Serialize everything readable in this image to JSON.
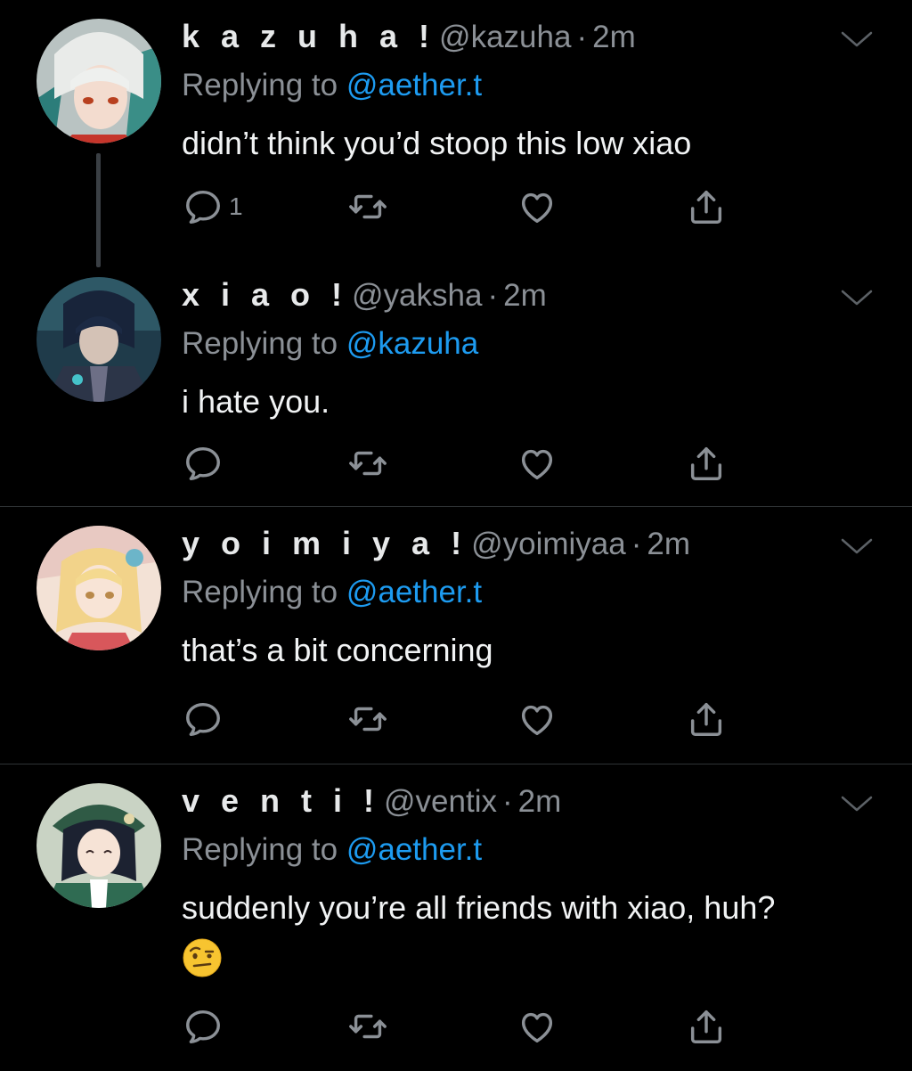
{
  "tweets": [
    {
      "name": "k a z u h a !",
      "handle": "@kazuha",
      "time": "2m",
      "replying_label": "Replying to",
      "replying_to": "@aether.t",
      "text": "didn’t think you’d stoop this low xiao",
      "reply_count": "1",
      "avatar": "kazuha-avatar"
    },
    {
      "name": "x i a o !",
      "handle": "@yaksha",
      "time": "2m",
      "replying_label": "Replying to",
      "replying_to": "@kazuha",
      "text": "i hate you.",
      "reply_count": "",
      "avatar": "xiao-avatar"
    },
    {
      "name": "y o i m i y a !",
      "handle": "@yoimiyaa",
      "time": "2m",
      "replying_label": "Replying to",
      "replying_to": "@aether.t",
      "text": "that’s a bit concerning",
      "reply_count": "",
      "avatar": "yoimiya-avatar"
    },
    {
      "name": "v e n t i !",
      "handle": "@ventix",
      "time": "2m",
      "replying_label": "Replying to",
      "replying_to": "@aether.t",
      "text": "suddenly you’re all friends with xiao, huh?",
      "emoji": "face-with-raised-eyebrow",
      "reply_count": "",
      "avatar": "venti-avatar"
    }
  ],
  "colors": {
    "background": "#000000",
    "text": "#e7e9ea",
    "secondary": "#8b9096",
    "accent": "#1d9bf0",
    "divider": "#2f3336"
  },
  "icons": [
    "reply-icon",
    "retweet-icon",
    "like-icon",
    "share-icon",
    "chevron-down-icon"
  ]
}
